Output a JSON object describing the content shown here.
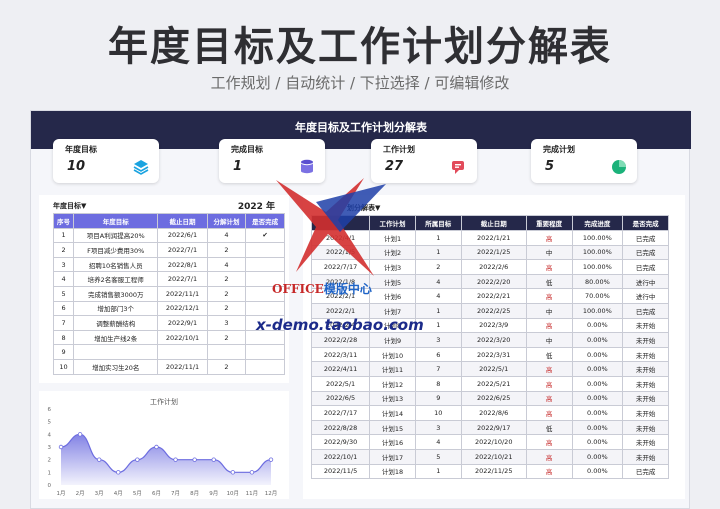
{
  "hero": {
    "title": "年度目标及工作计划分解表",
    "subtitle": "工作规划 / 自动统计 / 下拉选择 / 可编辑修改"
  },
  "sheet": {
    "banner": "年度目标及工作计划分解表",
    "cards": [
      {
        "label": "年度目标",
        "value": "10",
        "icon": "layers-icon",
        "color": "#1aa3e0"
      },
      {
        "label": "完成目标",
        "value": "1",
        "icon": "database-icon",
        "color": "#5a4fd0"
      },
      {
        "label": "工作计划",
        "value": "27",
        "icon": "chat-icon",
        "color": "#e24b5b"
      },
      {
        "label": "完成计划",
        "value": "5",
        "icon": "pie-icon",
        "color": "#1bb27a"
      }
    ],
    "left": {
      "filter_label": "年度目标▼",
      "year": "2022 年",
      "columns": [
        "序号",
        "年度目标",
        "截止日期",
        "分解计划",
        "是否完成"
      ],
      "rows": [
        [
          "1",
          "项目A利润提高20%",
          "2022/6/1",
          "4",
          "✔"
        ],
        [
          "2",
          "F项目减少费用30%",
          "2022/7/1",
          "2",
          ""
        ],
        [
          "3",
          "招聘10名销售人员",
          "2022/8/1",
          "4",
          ""
        ],
        [
          "4",
          "培养2名客服工程师",
          "2022/7/1",
          "2",
          ""
        ],
        [
          "5",
          "完成销售额3000万",
          "2022/11/1",
          "2",
          ""
        ],
        [
          "6",
          "增加部门3个",
          "2022/12/1",
          "2",
          ""
        ],
        [
          "7",
          "调整薪酬结构",
          "2022/9/1",
          "3",
          ""
        ],
        [
          "8",
          "增加生产线2条",
          "2022/10/1",
          "2",
          ""
        ],
        [
          "9",
          "",
          "",
          "",
          ""
        ],
        [
          "10",
          "增加实习生20名",
          "2022/11/1",
          "2",
          ""
        ]
      ]
    },
    "right": {
      "filter_label": "划分解表▼",
      "columns": [
        "",
        "工作计划",
        "所属目标",
        "截止日期",
        "重要程度",
        "完成进度",
        "是否完成"
      ],
      "rows": [
        [
          "2022/4/1",
          "计划1",
          "1",
          "2022/1/21",
          "高",
          "100.00%",
          "已完成"
        ],
        [
          "2022/1/5",
          "计划2",
          "1",
          "2022/1/25",
          "中",
          "100.00%",
          "已完成"
        ],
        [
          "2022/7/17",
          "计划3",
          "2",
          "2022/2/6",
          "高",
          "100.00%",
          "已完成"
        ],
        [
          "2022/1/8",
          "计划5",
          "4",
          "2022/2/20",
          "低",
          "80.00%",
          "进行中"
        ],
        [
          "2022/2/1",
          "计划6",
          "4",
          "2022/2/21",
          "高",
          "70.00%",
          "进行中"
        ],
        [
          "2022/2/1",
          "计划7",
          "1",
          "2022/2/25",
          "中",
          "100.00%",
          "已完成"
        ],
        [
          "2022/2/4",
          "计划8",
          "1",
          "2022/3/9",
          "高",
          "0.00%",
          "未开始"
        ],
        [
          "2022/2/28",
          "计划9",
          "3",
          "2022/3/20",
          "中",
          "0.00%",
          "未开始"
        ],
        [
          "2022/3/11",
          "计划10",
          "6",
          "2022/3/31",
          "低",
          "0.00%",
          "未开始"
        ],
        [
          "2022/4/11",
          "计划11",
          "7",
          "2022/5/1",
          "高",
          "0.00%",
          "未开始"
        ],
        [
          "2022/5/1",
          "计划12",
          "8",
          "2022/5/21",
          "高",
          "0.00%",
          "未开始"
        ],
        [
          "2022/6/5",
          "计划13",
          "9",
          "2022/6/25",
          "高",
          "0.00%",
          "未开始"
        ],
        [
          "2022/7/17",
          "计划14",
          "10",
          "2022/8/6",
          "高",
          "0.00%",
          "未开始"
        ],
        [
          "2022/8/28",
          "计划15",
          "3",
          "2022/9/17",
          "低",
          "0.00%",
          "未开始"
        ],
        [
          "2022/9/30",
          "计划16",
          "4",
          "2022/10/20",
          "高",
          "0.00%",
          "未开始"
        ],
        [
          "2022/10/1",
          "计划17",
          "5",
          "2022/10/21",
          "高",
          "0.00%",
          "未开始"
        ],
        [
          "2022/11/5",
          "计划18",
          "1",
          "2022/11/25",
          "高",
          "0.00%",
          "已完成"
        ]
      ]
    },
    "chart_data": {
      "type": "area",
      "title": "工作计划",
      "categories": [
        "1月",
        "2月",
        "3月",
        "4月",
        "5月",
        "6月",
        "7月",
        "8月",
        "9月",
        "10月",
        "11月",
        "12月"
      ],
      "values": [
        3,
        4,
        2,
        1,
        2,
        3,
        2,
        2,
        2,
        1,
        1,
        2
      ],
      "ylim": [
        0,
        6
      ],
      "yticks": [
        0,
        1,
        2,
        3,
        4,
        5,
        6
      ],
      "color": "#6d6de0"
    },
    "watermark": {
      "brand_en": "OFFICE",
      "brand_cn": "模版中心",
      "url": "x-demo.taobao.com"
    }
  }
}
